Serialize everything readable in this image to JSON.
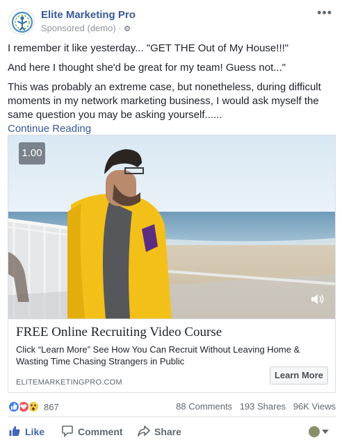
{
  "post": {
    "page_name": "Elite Marketing Pro",
    "sponsored": "Sponsored (demo) · ",
    "more_icon": "ellipsis-icon",
    "text": {
      "line1": "I remember it like yesterday... \"GET THE Out of My House!!!\"",
      "line2": "And here I thought she'd be great for my team! Guess not...\"",
      "line3": "This was probably an extreme case, but nonetheless, during difficult moments in my network marketing business, I would ask myself the same question you may be asking yourself......",
      "continue": "Continue Reading"
    }
  },
  "video": {
    "speed": "1.00",
    "volume_icon": "speaker-icon"
  },
  "ad": {
    "title": "FREE Online Recruiting Video Course",
    "description": "Click “Learn More” See How You Can Recruit Without Leaving Home & Wasting Time Chasing Strangers in Public",
    "domain": "ELITEMARKETINGPRO.COM",
    "cta": "Learn More"
  },
  "stats": {
    "reaction_count": "867",
    "comments": "88 Comments",
    "shares": "193 Shares",
    "views": "96K Views",
    "reaction_icons": [
      "like-reaction-icon",
      "love-reaction-icon",
      "wow-reaction-icon"
    ]
  },
  "actions": {
    "like": "Like",
    "comment": "Comment",
    "share": "Share"
  },
  "colors": {
    "link_blue": "#385898",
    "like_blue": "#4267b2",
    "text": "#1d2129",
    "muted": "#90949c",
    "jersey_yellow": "#f2c019"
  }
}
